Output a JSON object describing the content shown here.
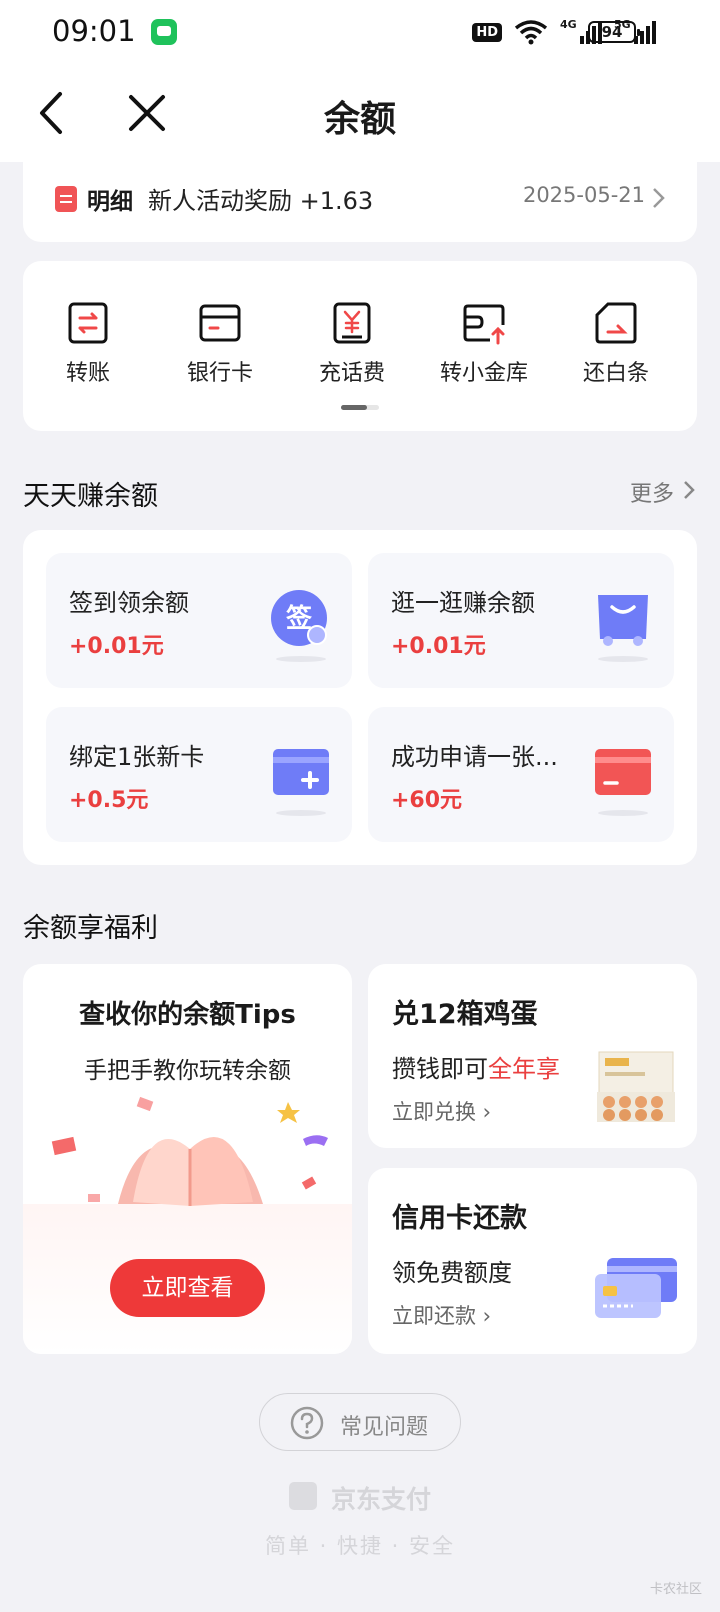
{
  "status_bar": {
    "time": "09:01",
    "hd": "HD",
    "net1": "4G",
    "net2": "5G",
    "battery": "94"
  },
  "nav": {
    "title": "余额"
  },
  "detail": {
    "label": "明细",
    "text": "新人活动奖励 +1.63",
    "date": "2025-05-21"
  },
  "actions": [
    {
      "label": "转账",
      "icon": "transfer-icon"
    },
    {
      "label": "银行卡",
      "icon": "bank-card-icon"
    },
    {
      "label": "充话费",
      "icon": "phone-recharge-icon"
    },
    {
      "label": "转小金库",
      "icon": "vault-transfer-icon"
    },
    {
      "label": "还白条",
      "icon": "baitiao-repay-icon"
    }
  ],
  "earn": {
    "title": "天天赚余额",
    "more": "更多",
    "tasks": [
      {
        "title": "签到领余额",
        "reward": "+0.01元",
        "badge": "签"
      },
      {
        "title": "逛一逛赚余额",
        "reward": "+0.01元"
      },
      {
        "title": "绑定1张新卡",
        "reward": "+0.5元"
      },
      {
        "title": "成功申请一张...",
        "reward": "+60元"
      }
    ]
  },
  "welfare": {
    "title": "余额享福利",
    "tips": {
      "title": "查收你的余额Tips",
      "subtitle": "手把手教你玩转余额",
      "button": "立即查看"
    },
    "eggs": {
      "title": "兑12箱鸡蛋",
      "sub_prefix": "攒钱即可",
      "sub_highlight": "全年享",
      "link": "立即兑换"
    },
    "credit": {
      "title": "信用卡还款",
      "sub": "领免费额度",
      "link": "立即还款"
    }
  },
  "faq": {
    "label": "常见问题"
  },
  "brand": {
    "name": "京东支付",
    "logo_text": "东付",
    "slogan": "简单 · 快捷 · 安全"
  },
  "watermark": "卡农社区",
  "colors": {
    "accent_red": "#ea3f3f",
    "button_red": "#ee3939",
    "task_blue": "#6f7cf7",
    "background": "#f2f2f6"
  }
}
